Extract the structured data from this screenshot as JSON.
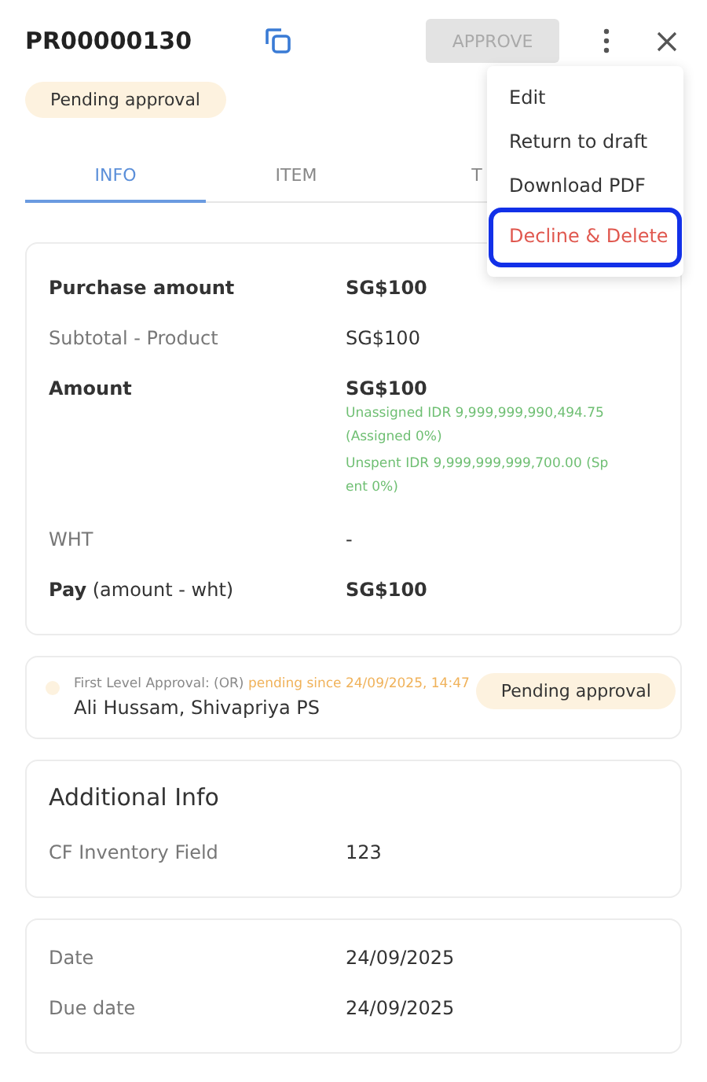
{
  "header": {
    "title": "PR00000130",
    "approve_button": {
      "label": "APPROVE",
      "disabled": true
    },
    "status": "Pending approval"
  },
  "tabs": [
    {
      "label": "INFO",
      "selected": true
    },
    {
      "label": "ITEM",
      "selected": false
    },
    {
      "label": "T",
      "selected": false
    }
  ],
  "menu": [
    {
      "label": "Edit",
      "kind": "normal",
      "highlighted": false
    },
    {
      "label": "Return to draft",
      "kind": "normal",
      "highlighted": false
    },
    {
      "label": "Download PDF",
      "kind": "normal",
      "highlighted": false
    },
    {
      "label": "Decline & Delete",
      "kind": "danger",
      "highlighted": true
    }
  ],
  "summary": [
    {
      "label": "Purchase amount",
      "value": "SG$100",
      "bold": true
    },
    {
      "label": "Subtotal - Product",
      "value": "SG$100",
      "bold": false
    },
    {
      "label": "Amount",
      "value": "SG$100",
      "bold": true,
      "notes": [
        "Unassigned IDR 9,999,999,990,494.75 (Assigned 0%)",
        "Unspent IDR 9,999,999,999,700.00 (Spent 0%)"
      ]
    },
    {
      "label": "WHT",
      "value": "-",
      "bold": false
    },
    {
      "label": "**Pay** (amount - wht)",
      "value": "SG$100",
      "bold": true
    }
  ],
  "approval": {
    "level": "First Level Approval: (OR)",
    "since": "pending since 24/09/2025, 14:47",
    "approvers": "Ali Hussam, Shivapriya PS",
    "status": "Pending approval"
  },
  "additional_info": {
    "title": "Additional Info",
    "rows": [
      {
        "label": "CF Inventory Field",
        "value": "123"
      }
    ]
  },
  "dates": [
    {
      "label": "Date",
      "value": "24/09/2025"
    },
    {
      "label": "Due date",
      "value": "24/09/2025"
    }
  ]
}
